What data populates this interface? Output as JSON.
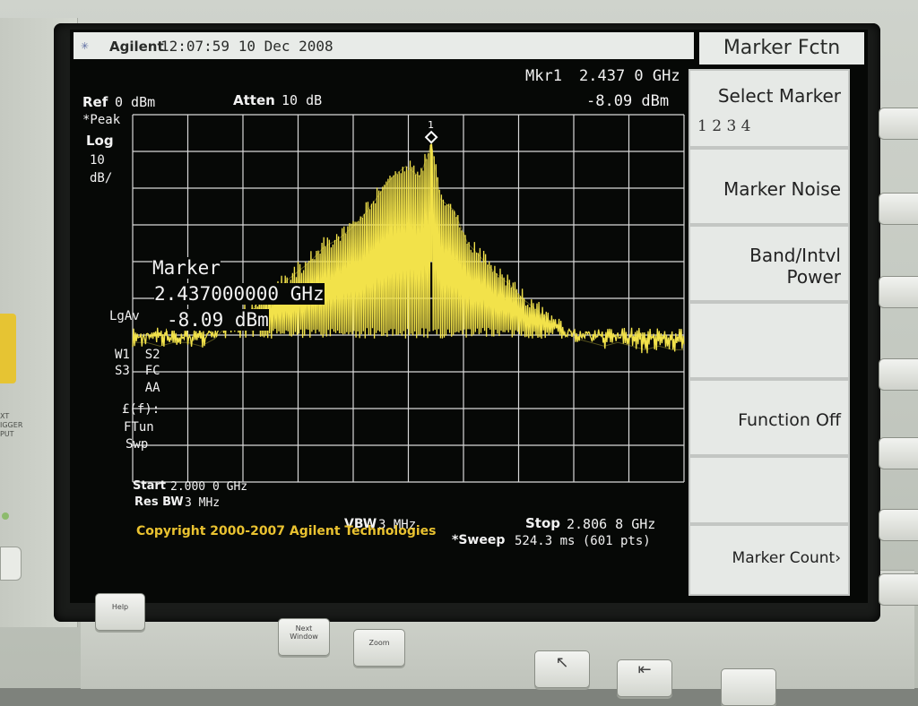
{
  "header": {
    "brand": "Agilent",
    "datetime": "12:07:59  10 Dec 2008"
  },
  "settings": {
    "ref_label": "Ref",
    "ref_value": "0 dBm",
    "atten_label": "Atten",
    "atten_value": "10 dB",
    "detector": "*Peak",
    "scale_type": "Log",
    "scale_value": "10",
    "scale_unit": "dB/",
    "avg_label": "LgAv",
    "trace_flags": [
      "W1  S2",
      "S3  FC",
      "    AA",
      "£(f):",
      "FTun",
      "Swp"
    ]
  },
  "marker_readout": {
    "label": "Mkr1",
    "freq": "2.437 0 GHz",
    "amp": "-8.09 dBm",
    "id": "1"
  },
  "active_marker": {
    "title": "Marker",
    "freq": "2.437000000 GHz",
    "amp": "-8.09 dBm"
  },
  "footer": {
    "start_label": "Start",
    "start_value": "2.000 0 GHz",
    "resbw_label": "Res BW",
    "resbw_value": "3 MHz",
    "vbw_label": "VBW",
    "vbw_value": "3 MHz",
    "stop_label": "Stop",
    "stop_value": "2.806 8 GHz",
    "sweep_label": "*Sweep",
    "sweep_value": "524.3 ms (601 pts)",
    "copyright": "Copyright 2000-2007 Agilent Technologies"
  },
  "softkeys": {
    "title": "Marker Fctn",
    "select_marker": "Select Marker",
    "select_marker_options": "1    2    3    4",
    "marker_noise": "Marker Noise",
    "band_power_line1": "Band/Intvl",
    "band_power_line2": "Power",
    "function_off": "Function Off",
    "marker_count": "Marker Count›"
  },
  "front_panel": {
    "left_label": "XT\nIGGER\nPUT",
    "help": "Help",
    "next_window": "Next\nWindow",
    "zoom": "Zoom"
  },
  "colors": {
    "trace": "#f2e24a",
    "grid": "#d8d8d8",
    "screen_bg": "#060806",
    "softkey_bg": "#e6e9e6",
    "copyright": "#e9c230"
  },
  "chart_data": {
    "type": "line",
    "xlabel": "",
    "ylabel": "",
    "xlim": [
      2.0,
      2.8068
    ],
    "ylim": [
      -100,
      0
    ],
    "grid": true,
    "peak": {
      "x": 2.437,
      "y": -8.09
    },
    "series": [
      {
        "x": [
          2.0,
          2.02,
          2.04,
          2.06,
          2.08,
          2.1,
          2.12,
          2.14,
          2.16,
          2.18,
          2.2,
          2.22,
          2.24,
          2.26,
          2.28,
          2.3,
          2.32,
          2.34,
          2.36,
          2.38,
          2.4,
          2.42,
          2.437,
          2.45,
          2.47,
          2.49,
          2.51,
          2.53,
          2.55,
          2.57,
          2.59,
          2.61,
          2.63,
          2.65,
          2.67,
          2.69,
          2.71,
          2.73,
          2.75,
          2.77,
          2.79,
          2.8068
        ],
        "y": [
          -62,
          -62,
          -63,
          -62,
          -62,
          -63,
          -61,
          -57,
          -55,
          -52,
          -49,
          -46,
          -43,
          -40,
          -36,
          -34,
          -31,
          -27,
          -22,
          -17,
          -14,
          -17,
          -8.09,
          -23,
          -26,
          -35,
          -39,
          -43,
          -46,
          -50,
          -53,
          -56,
          -59,
          -61,
          -62,
          -63,
          -62,
          -63,
          -64,
          -63,
          -64,
          -64
        ]
      }
    ]
  }
}
